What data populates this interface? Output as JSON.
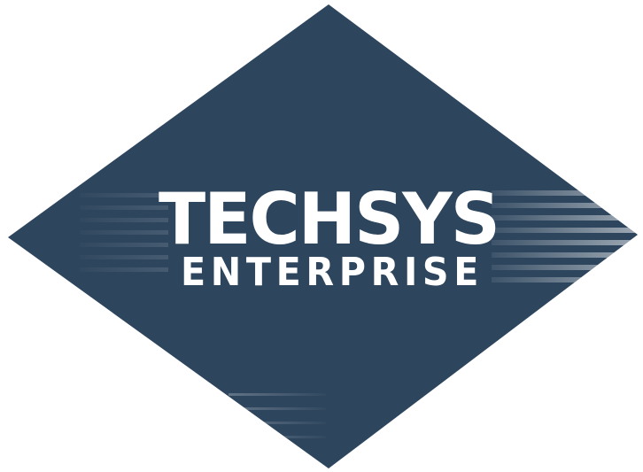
{
  "logo": {
    "title": "TECHSYS",
    "subtitle": "ENTERPRISE",
    "colors": {
      "diamond": "#2d455d",
      "text": "#ffffff",
      "stripes": "#ffffff",
      "background": "#ffffff"
    }
  }
}
